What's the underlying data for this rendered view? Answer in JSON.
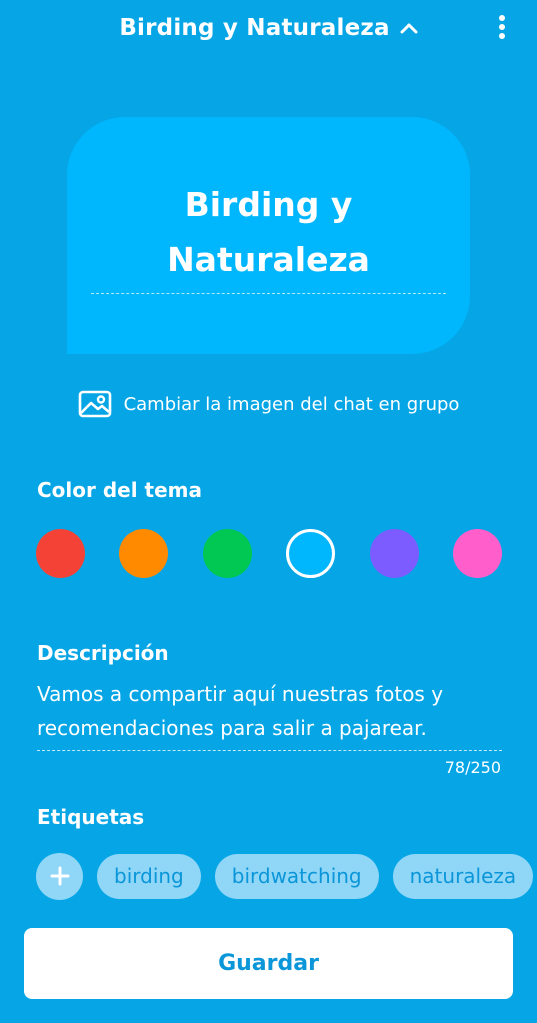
{
  "header": {
    "title": "Birding y Naturaleza",
    "chevron_icon": "chevron-up-icon",
    "menu_icon": "more-vertical-icon"
  },
  "group_card": {
    "name_line1": "Birding y",
    "name_line2": "Naturaleza"
  },
  "change_image": {
    "label": "Cambiar la imagen del chat en grupo",
    "icon": "image-icon"
  },
  "theme": {
    "heading": "Color del tema",
    "colors": [
      "#f44336",
      "#ff8a00",
      "#00c853",
      "#00b6fd",
      "#7c5cff",
      "#ff5ecb"
    ],
    "selected_index": 3
  },
  "description": {
    "heading": "Descripción",
    "value": "Vamos a compartir aquí nuestras fotos y recomendaciones para salir a pajarear.",
    "char_count": "78/250"
  },
  "tags": {
    "heading": "Etiquetas",
    "add_icon": "plus-icon",
    "items": [
      "birding",
      "birdwatching",
      "naturaleza"
    ]
  },
  "save_button": {
    "label": "Guardar"
  },
  "colors": {
    "background": "#06a6e6",
    "card": "#00b6fd",
    "chip": "#8fd6f7",
    "accent_text": "#0a96d8"
  }
}
